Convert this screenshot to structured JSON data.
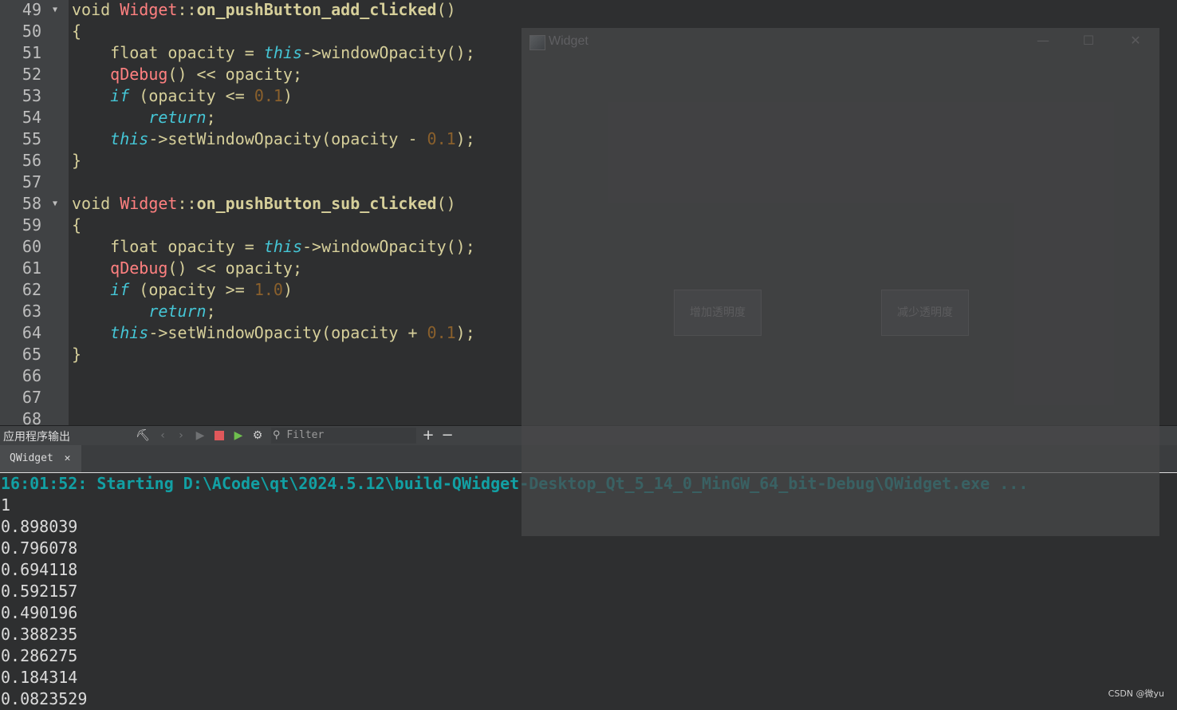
{
  "editor": {
    "lines": [
      {
        "num": "49",
        "fold": true,
        "tokens": [
          {
            "t": "void ",
            "c": "kw"
          },
          {
            "t": "Widget",
            "c": "cls"
          },
          {
            "t": "::",
            "c": "plain"
          },
          {
            "t": "on_pushButton_add_clicked",
            "c": "fn"
          },
          {
            "t": "()",
            "c": "plain"
          }
        ]
      },
      {
        "num": "50",
        "fold": false,
        "tokens": [
          {
            "t": "{",
            "c": "plain"
          }
        ]
      },
      {
        "num": "51",
        "fold": false,
        "tokens": [
          {
            "t": "    float ",
            "c": "kw"
          },
          {
            "t": "opacity ",
            "c": "var"
          },
          {
            "t": "= ",
            "c": "plain"
          },
          {
            "t": "this",
            "c": "it"
          },
          {
            "t": "->windowOpacity();",
            "c": "plain"
          }
        ]
      },
      {
        "num": "52",
        "fold": false,
        "tokens": [
          {
            "t": "    ",
            "c": "plain"
          },
          {
            "t": "qDebug",
            "c": "cls"
          },
          {
            "t": "() << opacity;",
            "c": "plain"
          }
        ]
      },
      {
        "num": "53",
        "fold": false,
        "tokens": [
          {
            "t": "    ",
            "c": "plain"
          },
          {
            "t": "if",
            "c": "it"
          },
          {
            "t": " (opacity <= ",
            "c": "plain"
          },
          {
            "t": "0.1",
            "c": "num"
          },
          {
            "t": ")",
            "c": "plain"
          }
        ]
      },
      {
        "num": "54",
        "fold": false,
        "tokens": [
          {
            "t": "        ",
            "c": "plain"
          },
          {
            "t": "return",
            "c": "it"
          },
          {
            "t": ";",
            "c": "plain"
          }
        ]
      },
      {
        "num": "55",
        "fold": false,
        "tokens": [
          {
            "t": "    ",
            "c": "plain"
          },
          {
            "t": "this",
            "c": "it"
          },
          {
            "t": "->setWindowOpacity(opacity - ",
            "c": "plain"
          },
          {
            "t": "0.1",
            "c": "num"
          },
          {
            "t": ");",
            "c": "plain"
          }
        ]
      },
      {
        "num": "56",
        "fold": false,
        "tokens": [
          {
            "t": "}",
            "c": "plain"
          }
        ]
      },
      {
        "num": "57",
        "fold": false,
        "tokens": []
      },
      {
        "num": "58",
        "fold": true,
        "tokens": [
          {
            "t": "void ",
            "c": "kw"
          },
          {
            "t": "Widget",
            "c": "cls"
          },
          {
            "t": "::",
            "c": "plain"
          },
          {
            "t": "on_pushButton_sub_clicked",
            "c": "fn"
          },
          {
            "t": "()",
            "c": "plain"
          }
        ]
      },
      {
        "num": "59",
        "fold": false,
        "tokens": [
          {
            "t": "{",
            "c": "plain"
          }
        ]
      },
      {
        "num": "60",
        "fold": false,
        "tokens": [
          {
            "t": "    float ",
            "c": "kw"
          },
          {
            "t": "opacity ",
            "c": "var"
          },
          {
            "t": "= ",
            "c": "plain"
          },
          {
            "t": "this",
            "c": "it"
          },
          {
            "t": "->windowOpacity();",
            "c": "plain"
          }
        ]
      },
      {
        "num": "61",
        "fold": false,
        "tokens": [
          {
            "t": "    ",
            "c": "plain"
          },
          {
            "t": "qDebug",
            "c": "cls"
          },
          {
            "t": "() << opacity;",
            "c": "plain"
          }
        ]
      },
      {
        "num": "62",
        "fold": false,
        "tokens": [
          {
            "t": "    ",
            "c": "plain"
          },
          {
            "t": "if",
            "c": "it"
          },
          {
            "t": " (opacity >= ",
            "c": "plain"
          },
          {
            "t": "1.0",
            "c": "num"
          },
          {
            "t": ")",
            "c": "plain"
          }
        ]
      },
      {
        "num": "63",
        "fold": false,
        "tokens": [
          {
            "t": "        ",
            "c": "plain"
          },
          {
            "t": "return",
            "c": "it"
          },
          {
            "t": ";",
            "c": "plain"
          }
        ]
      },
      {
        "num": "64",
        "fold": false,
        "tokens": [
          {
            "t": "    ",
            "c": "plain"
          },
          {
            "t": "this",
            "c": "it"
          },
          {
            "t": "->setWindowOpacity(opacity + ",
            "c": "plain"
          },
          {
            "t": "0.1",
            "c": "num"
          },
          {
            "t": ");",
            "c": "plain"
          }
        ]
      },
      {
        "num": "65",
        "fold": false,
        "tokens": [
          {
            "t": "}",
            "c": "plain"
          }
        ]
      },
      {
        "num": "66",
        "fold": false,
        "tokens": []
      },
      {
        "num": "67",
        "fold": false,
        "tokens": []
      },
      {
        "num": "68",
        "fold": false,
        "tokens": []
      }
    ]
  },
  "widget_window": {
    "title": "Widget",
    "minimize_icon": "minimize-icon",
    "maximize_icon": "maximize-icon",
    "close_icon": "close-icon",
    "add_button_label": "增加透明度",
    "sub_button_label": "减少透明度"
  },
  "output_pane": {
    "title": "应用程序输出",
    "filter_placeholder": "Filter",
    "plus_label": "+",
    "minus_label": "−",
    "tab_label": "QWidget",
    "tab_close": "✕",
    "start_line": "16:01:52: Starting D:\\ACode\\qt\\2024.5.12\\build-QWidget-Desktop_Qt_5_14_0_MinGW_64_bit-Debug\\QWidget.exe ...",
    "values": [
      "1",
      "0.898039",
      "0.796078",
      "0.694118",
      "0.592157",
      "0.490196",
      "0.388235",
      "0.286275",
      "0.184314",
      "0.0823529"
    ]
  },
  "watermark": "CSDN @微yu"
}
